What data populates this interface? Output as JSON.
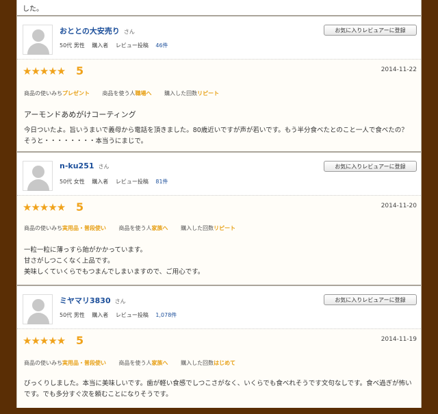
{
  "top_fragment": "した。",
  "fav_button_label": "お気に入りレビュアーに登録",
  "reviews": [
    {
      "name": "おととの大安売り",
      "suffix": "さん",
      "age_gender": "50代 男性",
      "buyer": "購入者",
      "posts_label": "レビュー投稿",
      "posts_count": "46件",
      "stars": "★★★★★",
      "score": "5",
      "date": "2014-11-22",
      "tags": [
        {
          "label": "商品の使いみち",
          "value": "プレゼント"
        },
        {
          "label": "商品を使う人",
          "value": "職場へ"
        },
        {
          "label": "購入した回数",
          "value": "リピート"
        }
      ],
      "title": "アーモンドあめがけコーティング",
      "text": "今日ついたよ。旨いうまいで義母から電話を頂きました。80歳近いですが声が若いです。もう半分食べたとのこと一人で食べたの？そうと・・・・・・・・本当うにまじで。"
    },
    {
      "name": "n-ku251",
      "suffix": "さん",
      "age_gender": "50代 女性",
      "buyer": "購入者",
      "posts_label": "レビュー投稿",
      "posts_count": "81件",
      "stars": "★★★★★",
      "score": "5",
      "date": "2014-11-20",
      "tags": [
        {
          "label": "商品の使いみち",
          "value": "実用品・普段使い"
        },
        {
          "label": "商品を使う人",
          "value": "家族へ"
        },
        {
          "label": "購入した回数",
          "value": "リピート"
        }
      ],
      "title": "",
      "lines": [
        "一粒一粒に薄っすら飴がかかっています。",
        "甘さがしつこくなく上品です。",
        "美味しくていくらでもつまんでしまいますので、ご用心です。"
      ]
    },
    {
      "name": "ミヤマリ3830",
      "suffix": "さん",
      "age_gender": "50代 男性",
      "buyer": "購入者",
      "posts_label": "レビュー投稿",
      "posts_count": "1,078件",
      "stars": "★★★★★",
      "score": "5",
      "date": "2014-11-19",
      "tags": [
        {
          "label": "商品の使いみち",
          "value": "実用品・普段使い"
        },
        {
          "label": "商品を使う人",
          "value": "家族へ"
        },
        {
          "label": "購入した回数",
          "value": "はじめて"
        }
      ],
      "title": "",
      "text": "びっくりしました。本当に美味しいです。歯が軽い食感でしつこさがなく、いくらでも食べれそうです文句なしです。食べ過ぎが怖いです。でも多分すぐ次を頼むことになりそうです。"
    }
  ],
  "colors": {
    "outer_background": "#5a2e05",
    "star_color": "#f0a31c",
    "link_color": "#1b4e9a"
  },
  "icons": {
    "avatar": "default-user-avatar-icon",
    "star": "star-icon"
  }
}
